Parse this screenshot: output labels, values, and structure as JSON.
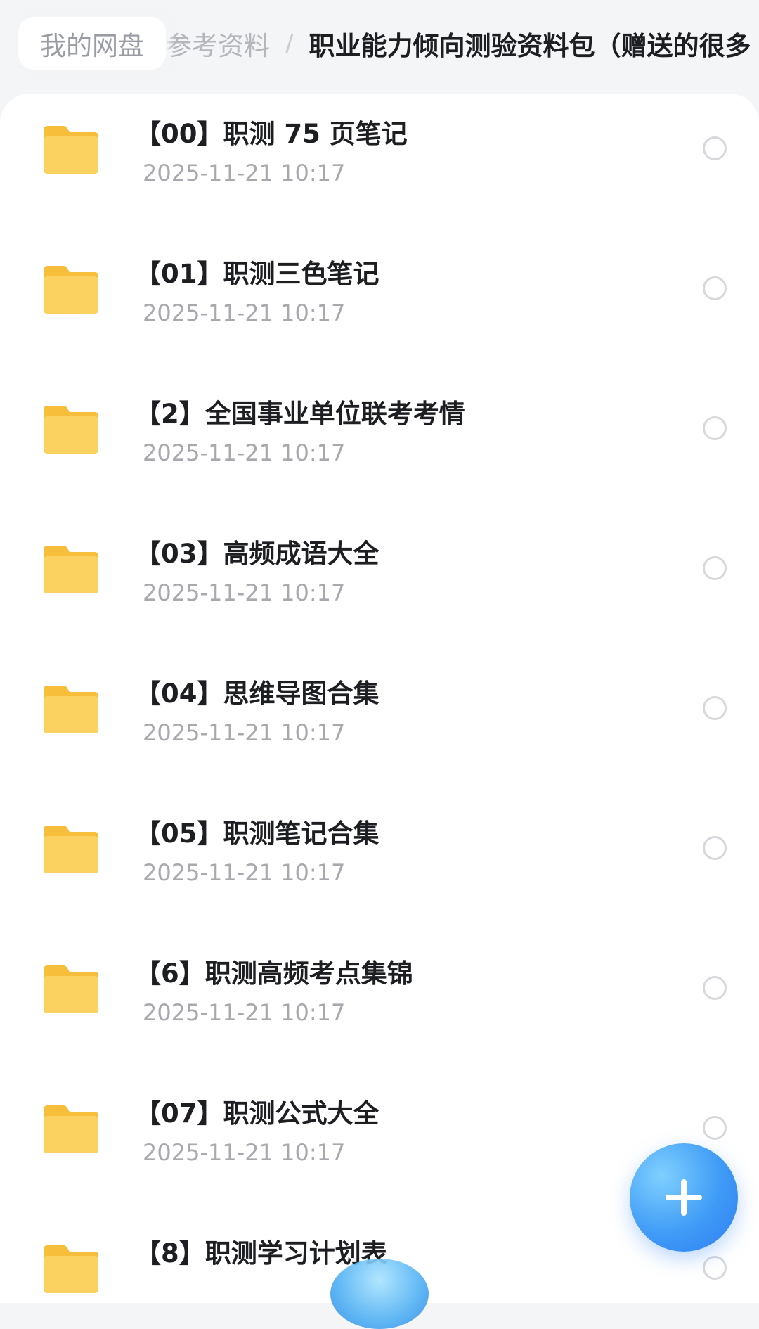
{
  "breadcrumb": {
    "home": "我的网盘",
    "parent": "参考资料",
    "separator": "/",
    "current": "职业能力倾向测验资料包（赠送的很多"
  },
  "icons": {
    "folder": "folder-icon",
    "radio": "select-radio",
    "fab": "plus-icon"
  },
  "colors": {
    "folder": "#F9C846",
    "accent": "#3F9BF6"
  },
  "files": [
    {
      "name": "【00】职测 75 页笔记",
      "date": "2025-11-21 10:17"
    },
    {
      "name": "【01】职测三色笔记",
      "date": "2025-11-21 10:17"
    },
    {
      "name": "【2】全国事业单位联考考情",
      "date": "2025-11-21 10:17"
    },
    {
      "name": "【03】高频成语大全",
      "date": "2025-11-21 10:17"
    },
    {
      "name": "【04】思维导图合集",
      "date": "2025-11-21 10:17"
    },
    {
      "name": "【05】职测笔记合集",
      "date": "2025-11-21 10:17"
    },
    {
      "name": "【6】职测高频考点集锦",
      "date": "2025-11-21 10:17"
    },
    {
      "name": "【07】职测公式大全",
      "date": "2025-11-21 10:17"
    },
    {
      "name": "【8】职测学习计划表",
      "date": ""
    }
  ]
}
